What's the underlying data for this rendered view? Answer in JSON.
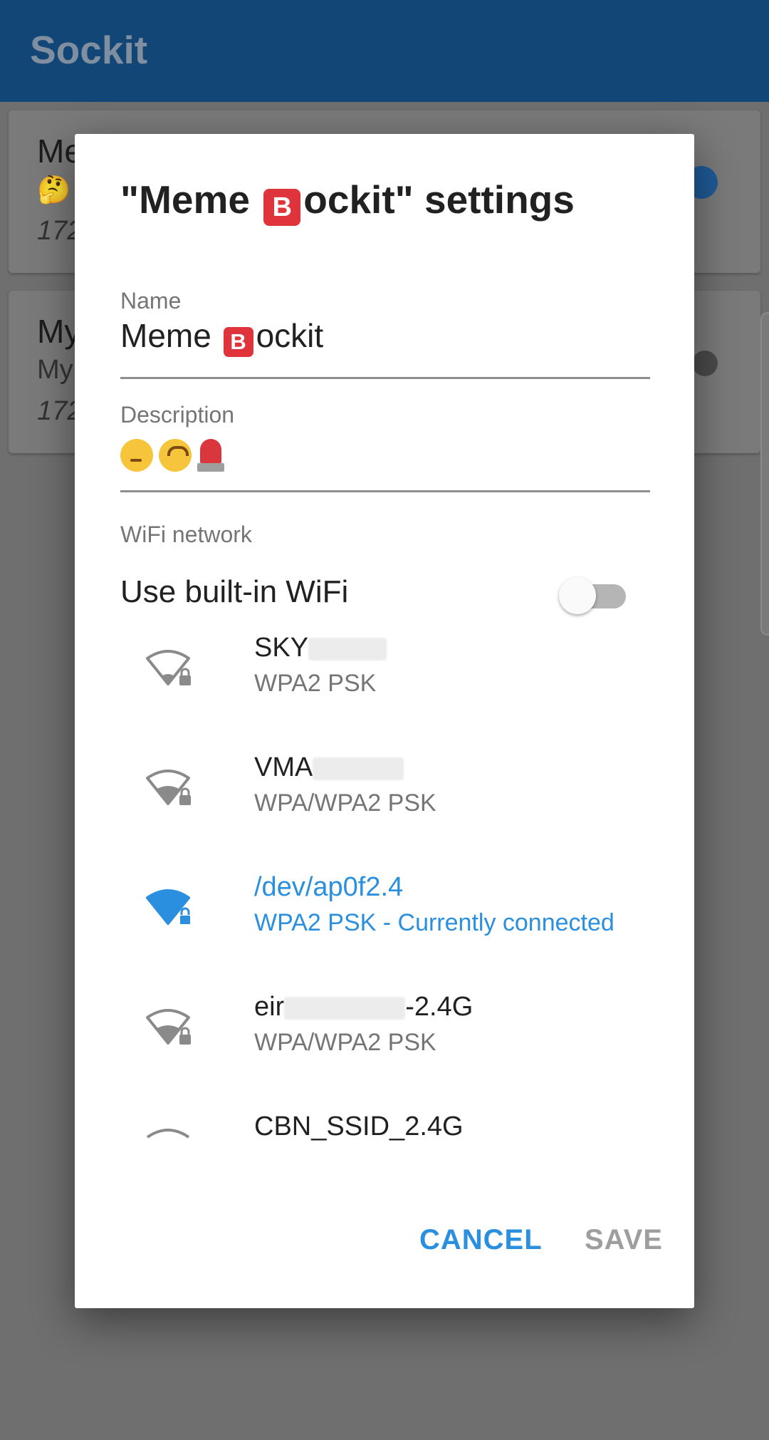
{
  "app": {
    "title": "Sockit"
  },
  "background_cards": [
    {
      "name": "Me",
      "description_start": "🤔",
      "ip_start": "172"
    },
    {
      "name": "My",
      "description_start": "My",
      "ip_start": "172"
    }
  ],
  "dialog": {
    "title_prefix": "\"Meme ",
    "title_emoji": "B",
    "title_suffix": "ockit\" settings",
    "name_label": "Name",
    "name_value_prefix": "Meme ",
    "name_value_emoji": "B",
    "name_value_suffix": "ockit",
    "description_label": "Description",
    "description_emojis": [
      "thinking-face",
      "upside-down-face",
      "police-light"
    ],
    "wifi_section_label": "WiFi network",
    "builtin_wifi_label": "Use built-in WiFi",
    "builtin_wifi_enabled": false,
    "networks": [
      {
        "ssid_visible": "SKY",
        "ssid_suffix": "",
        "security": "WPA2 PSK",
        "signal": "weak",
        "connected": false
      },
      {
        "ssid_visible": "VMA",
        "ssid_suffix": "",
        "security": "WPA/WPA2 PSK",
        "signal": "medium",
        "connected": false
      },
      {
        "ssid_visible": "/dev/ap0f2.4",
        "ssid_suffix": "",
        "security": "WPA2 PSK - Currently connected",
        "signal": "full",
        "connected": true
      },
      {
        "ssid_visible": "eir",
        "ssid_suffix": "-2.4G",
        "security": "WPA/WPA2 PSK",
        "signal": "medium",
        "connected": false
      },
      {
        "ssid_visible": "CBN_SSID_2.4G",
        "ssid_suffix": "",
        "security": "",
        "signal": "weak",
        "connected": false
      }
    ],
    "cancel_label": "CANCEL",
    "save_label": "SAVE"
  },
  "colors": {
    "app_bar": "#114677",
    "accent": "#2a8fde",
    "scrim": "#6f6f6f"
  }
}
